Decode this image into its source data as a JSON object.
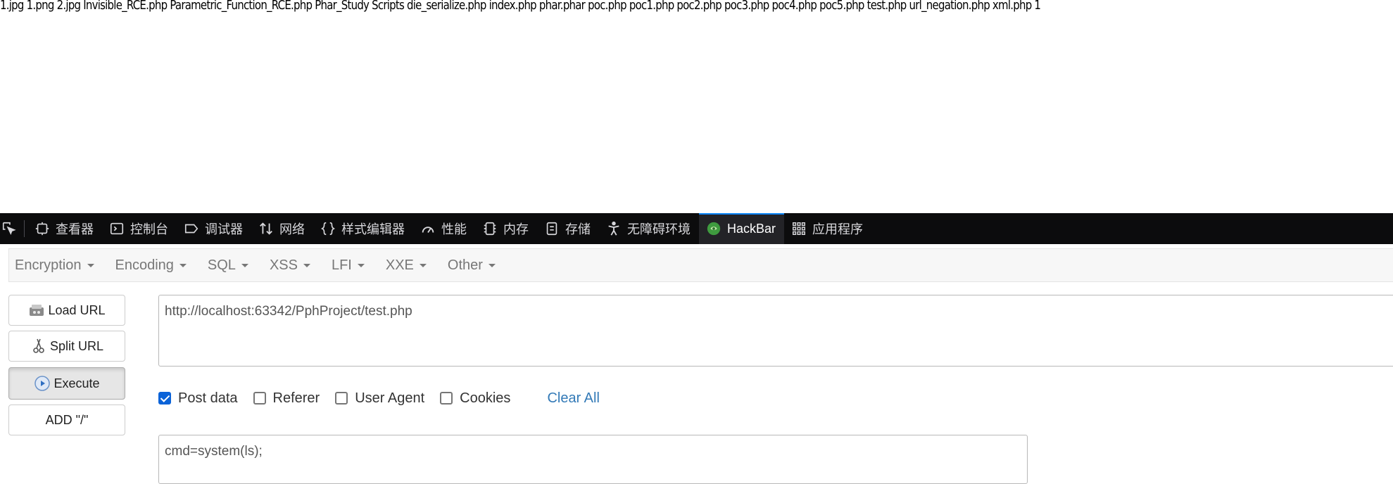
{
  "page": {
    "output_text": "1.jpg 1.png 2.jpg Invisible_RCE.php Parametric_Function_RCE.php Phar_Study Scripts die_serialize.php index.php phar.phar poc.php poc1.php poc2.php poc3.php poc4.php poc5.php test.php url_negation.php xml.php 1"
  },
  "devtools": {
    "tabs": [
      {
        "label": "查看器",
        "icon": "inspector-icon"
      },
      {
        "label": "控制台",
        "icon": "console-icon"
      },
      {
        "label": "调试器",
        "icon": "debugger-icon"
      },
      {
        "label": "网络",
        "icon": "network-icon"
      },
      {
        "label": "样式编辑器",
        "icon": "style-editor-icon"
      },
      {
        "label": "性能",
        "icon": "performance-icon"
      },
      {
        "label": "内存",
        "icon": "memory-icon"
      },
      {
        "label": "存储",
        "icon": "storage-icon"
      },
      {
        "label": "无障碍环境",
        "icon": "accessibility-icon"
      },
      {
        "label": "HackBar",
        "icon": "hackbar-icon",
        "selected": true
      },
      {
        "label": "应用程序",
        "icon": "application-icon"
      }
    ],
    "accent": "#0a84ff"
  },
  "hackbar": {
    "menus": [
      "Encryption",
      "Encoding",
      "SQL",
      "XSS",
      "LFI",
      "XXE",
      "Other"
    ],
    "buttons": {
      "load_url": "Load URL",
      "split_url": "Split URL",
      "execute": "Execute",
      "add_slash": "ADD \"/\""
    },
    "url_value": "http://localhost:63342/PphProject/test.php",
    "options": {
      "post_data": {
        "label": "Post data",
        "checked": true
      },
      "referer": {
        "label": "Referer",
        "checked": false
      },
      "user_agent": {
        "label": "User Agent",
        "checked": false
      },
      "cookies": {
        "label": "Cookies",
        "checked": false
      }
    },
    "clear_all": "Clear All",
    "post_value": "cmd=system(ls);",
    "link_color": "#337ab7",
    "checkbox_color": "#0b63d8"
  }
}
